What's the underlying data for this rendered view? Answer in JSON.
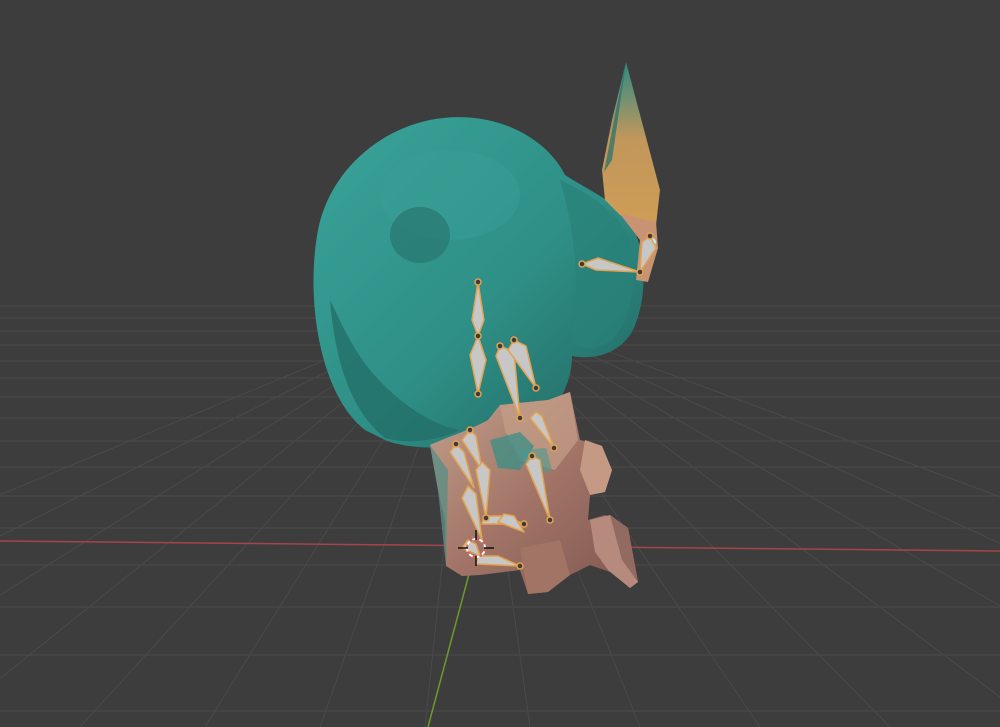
{
  "viewport": {
    "background_color": "#3d3d3d",
    "grid_color": "#4a4a4a",
    "x_axis_color": "#a5444b",
    "y_axis_color": "#6d9a2a"
  },
  "model": {
    "body_color": "#2e8f86",
    "body_shadow_color": "#236f69",
    "rock_color": "#9a6d63",
    "rock_light_color": "#bf9a86",
    "spike_color": "#c39a5d"
  },
  "armature": {
    "bone_fill_color": "#c7c7c7",
    "bone_outline_color": "#e3a24f",
    "bone_count": 16
  },
  "cursor": {
    "icon": "3d-cursor-icon"
  }
}
